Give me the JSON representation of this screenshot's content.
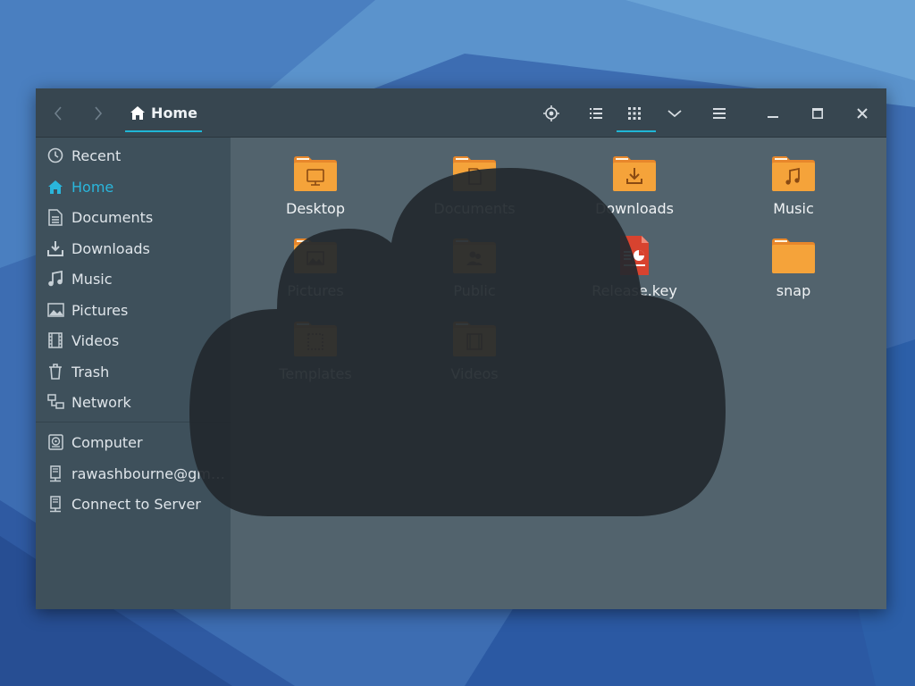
{
  "window": {
    "title": "Home"
  },
  "headerbar": {
    "back_icon": "chevron-left-icon",
    "forward_icon": "chevron-right-icon",
    "location_label": "Home",
    "location_icon": "home-icon",
    "buttons": [
      "locate-icon",
      "list-view-icon",
      "grid-view-icon",
      "chevron-down-icon",
      "hamburger-menu-icon",
      "minimize-icon",
      "maximize-icon",
      "close-icon"
    ]
  },
  "sidebar": {
    "items": [
      {
        "label": "Recent",
        "icon": "clock-icon"
      },
      {
        "label": "Home",
        "icon": "home-icon",
        "active": true
      },
      {
        "label": "Documents",
        "icon": "document-icon"
      },
      {
        "label": "Downloads",
        "icon": "download-icon"
      },
      {
        "label": "Music",
        "icon": "music-icon"
      },
      {
        "label": "Pictures",
        "icon": "picture-icon"
      },
      {
        "label": "Videos",
        "icon": "film-icon"
      },
      {
        "label": "Trash",
        "icon": "trash-icon"
      },
      {
        "label": "Network",
        "icon": "network-icon"
      }
    ],
    "devices": [
      {
        "label": "Computer",
        "icon": "harddisk-icon"
      },
      {
        "label": "rawashbourne@gm…",
        "icon": "server-icon"
      },
      {
        "label": "Connect to Server",
        "icon": "server-icon"
      }
    ]
  },
  "files": [
    {
      "name": "Desktop",
      "icon": "folder-desktop-icon"
    },
    {
      "name": "Documents",
      "icon": "folder-documents-icon"
    },
    {
      "name": "Downloads",
      "icon": "folder-downloads-icon"
    },
    {
      "name": "Music",
      "icon": "folder-music-icon"
    },
    {
      "name": "Pictures",
      "icon": "folder-pictures-icon"
    },
    {
      "name": "Public",
      "icon": "folder-public-icon"
    },
    {
      "name": "Release.key",
      "icon": "presentation-file-icon"
    },
    {
      "name": "snap",
      "icon": "folder-icon"
    },
    {
      "name": "Templates",
      "icon": "folder-templates-icon"
    },
    {
      "name": "Videos",
      "icon": "folder-videos-icon"
    }
  ],
  "overlay_icon": "cloud-icon",
  "colors": {
    "accent": "#1fb6d6",
    "folder": "#f5a33a",
    "folder_tab": "#e8872b",
    "cloud": "#22292e",
    "file_red": "#d8432f"
  }
}
